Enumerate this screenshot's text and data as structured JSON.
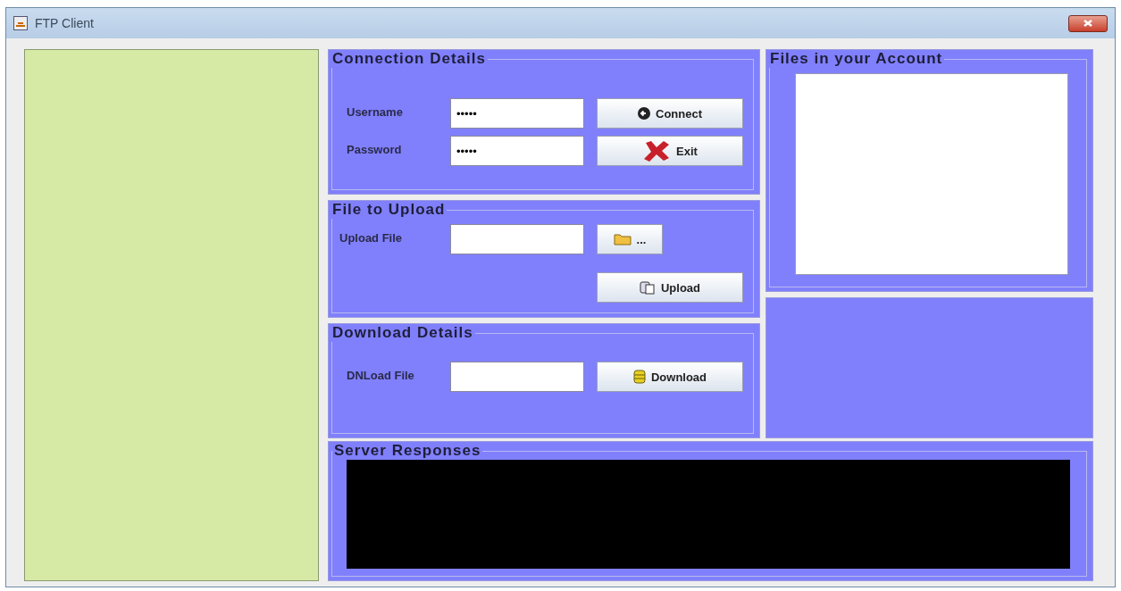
{
  "window": {
    "title": "FTP Client"
  },
  "connection": {
    "title": "Connection Details",
    "rows": [
      {
        "label": "Username",
        "value": "•••••",
        "button": {
          "label": "Connect",
          "kind": "back"
        }
      },
      {
        "label": "Password",
        "value": "•••••",
        "button": {
          "label": "Exit",
          "kind": "cross"
        }
      }
    ]
  },
  "upload": {
    "title": "File to Upload",
    "label": "Upload File",
    "browse": {
      "label": "...",
      "kind": "folder"
    },
    "button": {
      "label": "Upload",
      "kind": "copy"
    }
  },
  "download": {
    "title": "Download Details",
    "label": "DNLoad File",
    "button": {
      "label": "Download",
      "kind": "drum"
    }
  },
  "files": {
    "title": "Files in your Account"
  },
  "server": {
    "title": "Server Responses"
  }
}
